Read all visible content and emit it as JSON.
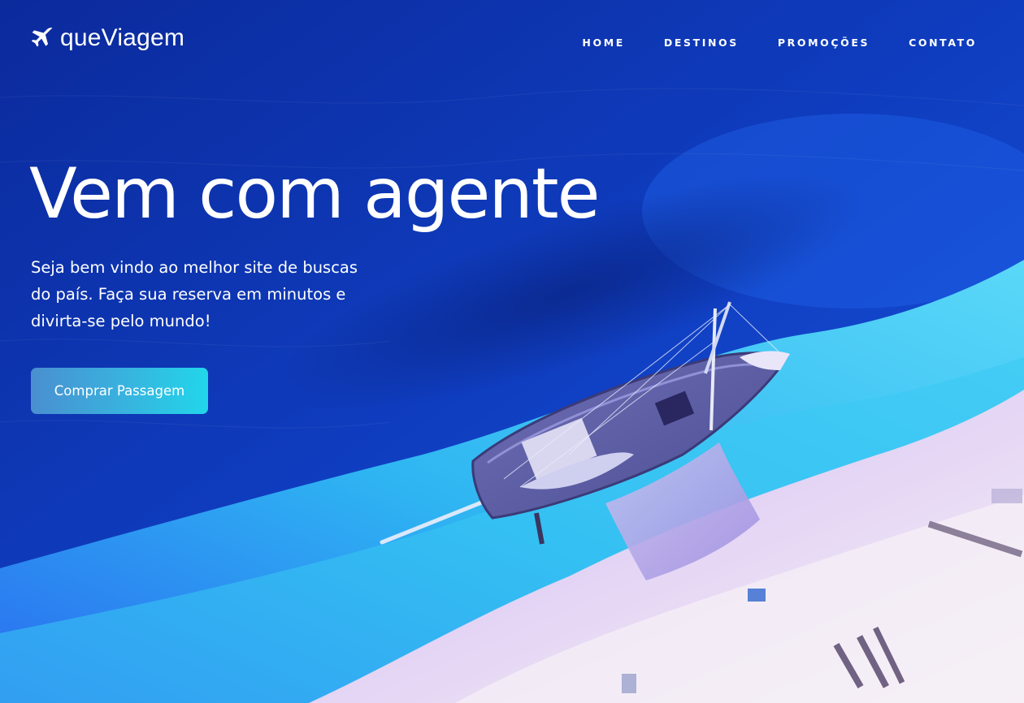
{
  "brand": {
    "name": "queViagem",
    "icon": "airplane-icon"
  },
  "nav": {
    "items": [
      {
        "label": "HOME"
      },
      {
        "label": "DESTINOS"
      },
      {
        "label": "PROMOÇÕES"
      },
      {
        "label": "CONTATO"
      }
    ]
  },
  "hero": {
    "headline": "Vem com agente",
    "subtitle": "Seja bem vindo ao melhor site de buscas do país. Faça sua reserva em minutos e divirta-se pelo mundo!",
    "cta_label": "Comprar Passagem"
  },
  "colors": {
    "ocean_deep": "#0a2fa0",
    "ocean_mid": "#1746d6",
    "shallow": "#28c8f0",
    "sand": "#f2eaf6",
    "accent_start": "#4a8fd0",
    "accent_end": "#22d6ea"
  }
}
